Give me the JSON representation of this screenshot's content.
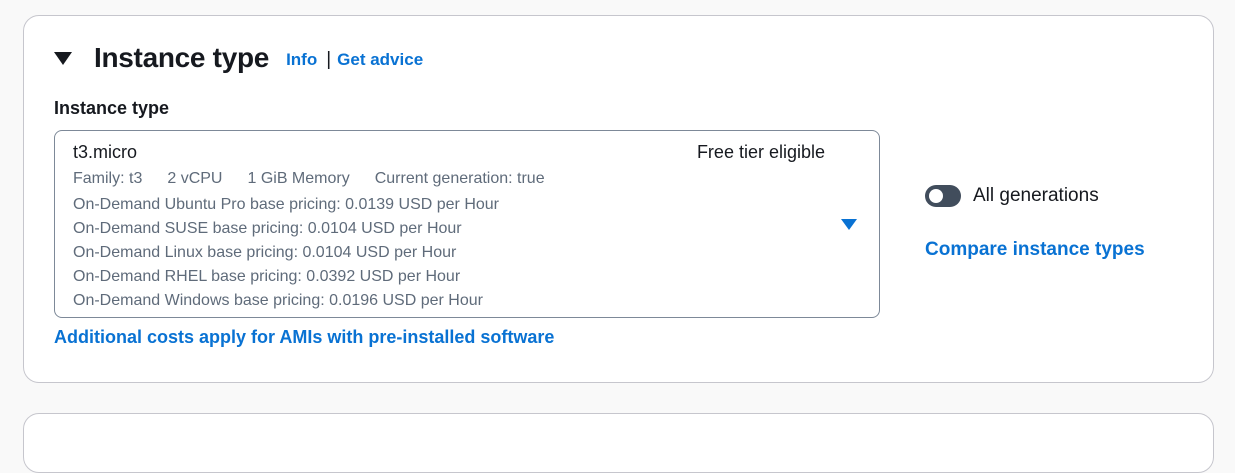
{
  "section": {
    "title": "Instance type",
    "info_link": "Info",
    "separator": "|",
    "advice_link": "Get advice"
  },
  "field": {
    "label": "Instance type",
    "selected": {
      "name": "t3.micro",
      "tag": "Free tier eligible",
      "attributes": [
        "Family: t3",
        "2 vCPU",
        "1 GiB Memory",
        "Current generation: true"
      ],
      "pricing": [
        "On-Demand Ubuntu Pro base pricing: 0.0139 USD per Hour",
        "On-Demand SUSE base pricing: 0.0104 USD per Hour",
        "On-Demand Linux base pricing: 0.0104 USD per Hour",
        "On-Demand RHEL base pricing: 0.0392 USD per Hour",
        "On-Demand Windows base pricing: 0.0196 USD per Hour"
      ]
    },
    "footer_link": "Additional costs apply for AMIs with pre-installed software"
  },
  "side": {
    "toggle_label": "All generations",
    "toggle_on": false,
    "compare_link": "Compare instance types"
  },
  "colors": {
    "link": "#0972d3",
    "text": "#16191f",
    "secondary_text": "#5f6b7a",
    "toggle_off": "#414d5c"
  },
  "icons": {
    "collapse": "caret-down-icon",
    "dropdown": "caret-down-filled-icon"
  }
}
